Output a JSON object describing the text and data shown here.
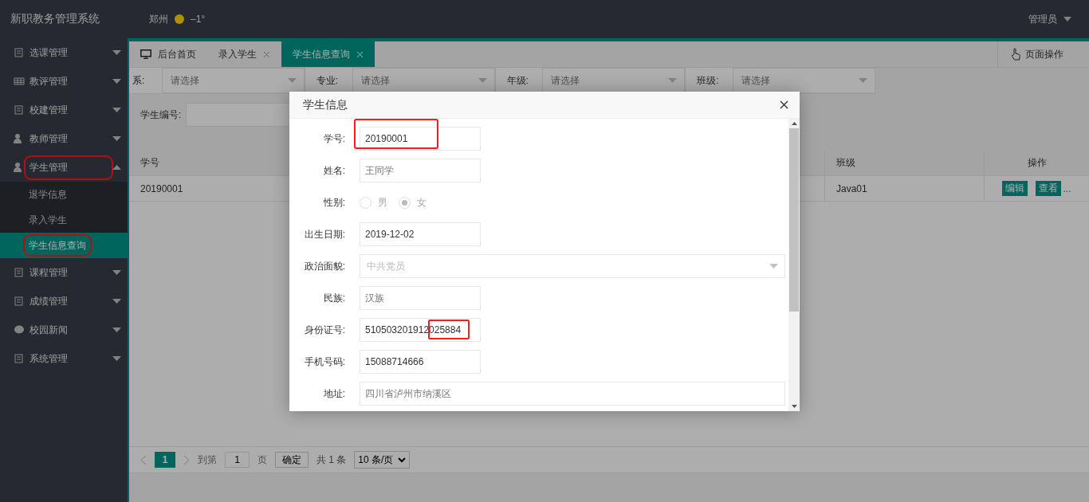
{
  "header": {
    "title": "新职教务管理系统",
    "city": "郑州",
    "temperature": "–1°",
    "user": "管理员"
  },
  "sidebar": {
    "items": [
      {
        "label": "选课管理",
        "expanded": false,
        "highlighted": false
      },
      {
        "label": "教评管理",
        "expanded": false,
        "highlighted": false
      },
      {
        "label": "校建管理",
        "expanded": false,
        "highlighted": false
      },
      {
        "label": "教师管理",
        "expanded": false,
        "highlighted": false
      },
      {
        "label": "学生管理",
        "expanded": true,
        "highlighted": true,
        "children": [
          {
            "label": "退学信息",
            "selected": false,
            "highlighted": false
          },
          {
            "label": "录入学生",
            "selected": false,
            "highlighted": false
          },
          {
            "label": "学生信息查询",
            "selected": true,
            "highlighted": true
          }
        ]
      },
      {
        "label": "课程管理",
        "expanded": false,
        "highlighted": false
      },
      {
        "label": "成绩管理",
        "expanded": false,
        "highlighted": false
      },
      {
        "label": "校园新闻",
        "expanded": false,
        "highlighted": false
      },
      {
        "label": "系统管理",
        "expanded": false,
        "highlighted": false
      }
    ]
  },
  "tabs": [
    {
      "label": "后台首页",
      "selected": false,
      "closable": false
    },
    {
      "label": "录入学生",
      "selected": false,
      "closable": true
    },
    {
      "label": "学生信息查询",
      "selected": true,
      "closable": true
    }
  ],
  "page_actions": "页面操作",
  "filters": [
    {
      "label": "系:",
      "placeholder": "请选择"
    },
    {
      "label": "专业:",
      "placeholder": "请选择"
    },
    {
      "label": "年级:",
      "placeholder": "请选择"
    },
    {
      "label": "班级:",
      "placeholder": "请选择"
    }
  ],
  "search": {
    "label": "学生编号:"
  },
  "table": {
    "columns": [
      "学号",
      "班级",
      "操作"
    ],
    "rows": [
      {
        "student_id": "20190001",
        "class": "Java01",
        "actions": [
          "编辑",
          "查看"
        ],
        "more": "..."
      }
    ]
  },
  "pagination": {
    "pages": [
      {
        "label": "1",
        "selected": true
      }
    ],
    "goto_label": "到第",
    "goto_value": "1",
    "page_unit": "页",
    "confirm": "确定",
    "total": "共 1 条",
    "page_size": "10 条/页"
  },
  "modal": {
    "title": "学生信息",
    "fields": [
      {
        "kind": "input",
        "label": "学号:",
        "value": "20190001",
        "disabled": false,
        "highlighted": true
      },
      {
        "kind": "input",
        "label": "姓名:",
        "value": "王同学",
        "disabled": true,
        "highlighted": false
      },
      {
        "kind": "radio",
        "label": "性别:",
        "options": [
          {
            "label": "男",
            "selected": false
          },
          {
            "label": "女",
            "selected": true
          }
        ]
      },
      {
        "kind": "input",
        "label": "出生日期:",
        "value": "2019-12-02",
        "disabled": false,
        "highlighted": false
      },
      {
        "kind": "select",
        "label": "政治面貌:",
        "value": "中共党员"
      },
      {
        "kind": "input",
        "label": "民族:",
        "value": "汉族",
        "disabled": true,
        "highlighted": false
      },
      {
        "kind": "input",
        "label": "身份证号:",
        "value": "510503201912025884",
        "disabled": false,
        "highlighted": false,
        "tail_highlighted": true
      },
      {
        "kind": "input",
        "label": "手机号码:",
        "value": "15088714666",
        "disabled": false,
        "highlighted": false
      },
      {
        "kind": "wide",
        "label": "地址:",
        "value": "四川省泸州市纳溪区",
        "disabled": true,
        "highlighted": false
      }
    ]
  }
}
